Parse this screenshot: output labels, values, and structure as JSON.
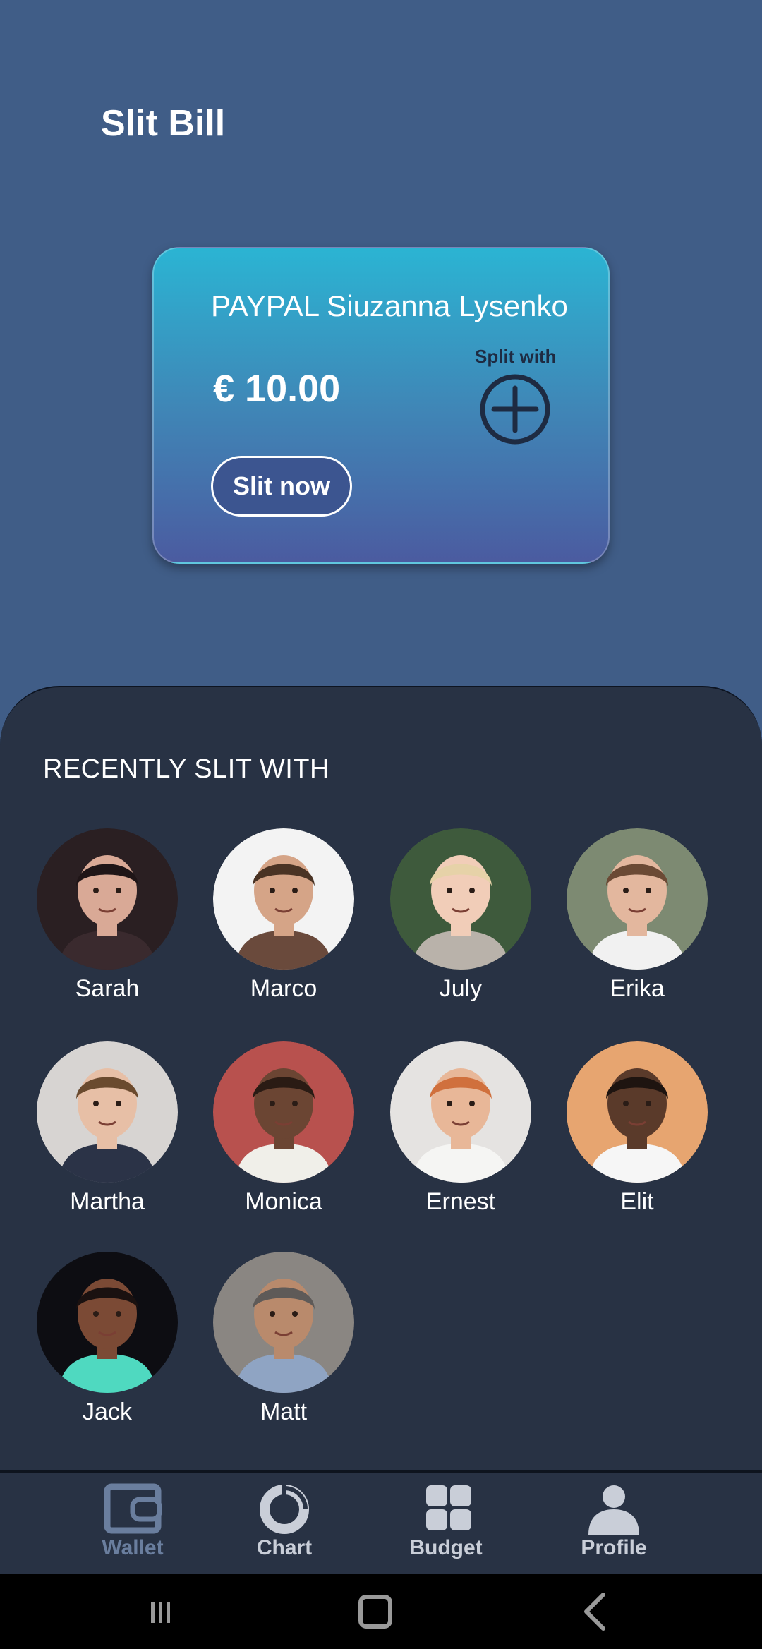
{
  "page": {
    "title": "Slit Bill"
  },
  "card": {
    "title": "PAYPAL Siuzanna Lysenko",
    "amount": "€ 10.00",
    "split_with_label": "Split with",
    "add_icon": "plus-circle-icon",
    "action_label": "Slit now"
  },
  "recent": {
    "heading": "RECENTLY SLIT WITH",
    "contacts": [
      {
        "name": "Sarah",
        "avatar_bg": "#2a1f22",
        "skin": "#d9a996",
        "hair": "#1f1517",
        "shirt": "#3a2a2e"
      },
      {
        "name": "Marco",
        "avatar_bg": "#f3f3f3",
        "skin": "#d5a487",
        "hair": "#4a3324",
        "shirt": "#6a4a3c"
      },
      {
        "name": "July",
        "avatar_bg": "#3e5a3c",
        "skin": "#f1cdb8",
        "hair": "#e6d2a8",
        "shirt": "#b9b2aa"
      },
      {
        "name": "Erika",
        "avatar_bg": "#7d8a72",
        "skin": "#e3b79e",
        "hair": "#6b4a35",
        "shirt": "#f1f1f1"
      },
      {
        "name": "Martha",
        "avatar_bg": "#d7d4d2",
        "skin": "#e7bfa6",
        "hair": "#6a4a2e",
        "shirt": "#2b3347"
      },
      {
        "name": "Monica",
        "avatar_bg": "#b8514e",
        "skin": "#6b4533",
        "hair": "#2a1b14",
        "shirt": "#f0efe9"
      },
      {
        "name": "Ernest",
        "avatar_bg": "#e5e3e1",
        "skin": "#e8b798",
        "hair": "#d0703d",
        "shirt": "#f5f5f3"
      },
      {
        "name": "Elit",
        "avatar_bg": "#e7a570",
        "skin": "#5a3a2a",
        "hair": "#1e1410",
        "shirt": "#f6f6f6"
      },
      {
        "name": "Jack",
        "avatar_bg": "#0d0d12",
        "skin": "#7b4a35",
        "hair": "#1a1110",
        "shirt": "#4fd9c0"
      },
      {
        "name": "Matt",
        "avatar_bg": "#8a8682",
        "skin": "#b98a6c",
        "hair": "#5e5a58",
        "shirt": "#8fa4c3"
      }
    ]
  },
  "nav": {
    "items": [
      {
        "label": "Wallet",
        "icon": "wallet-icon",
        "active": true
      },
      {
        "label": "Chart",
        "icon": "donut-chart-icon",
        "active": false
      },
      {
        "label": "Budget",
        "icon": "grid-icon",
        "active": false
      },
      {
        "label": "Profile",
        "icon": "person-icon",
        "active": false
      }
    ]
  },
  "system": {
    "buttons": [
      "recents-icon",
      "home-icon",
      "back-icon"
    ]
  },
  "colors": {
    "background": "#405d87",
    "panel": "#283244",
    "card_top": "#2bb4d3",
    "card_bottom": "#4b5ba0",
    "nav_active": "#6a7e9e",
    "nav_inactive": "#c9ced8"
  }
}
